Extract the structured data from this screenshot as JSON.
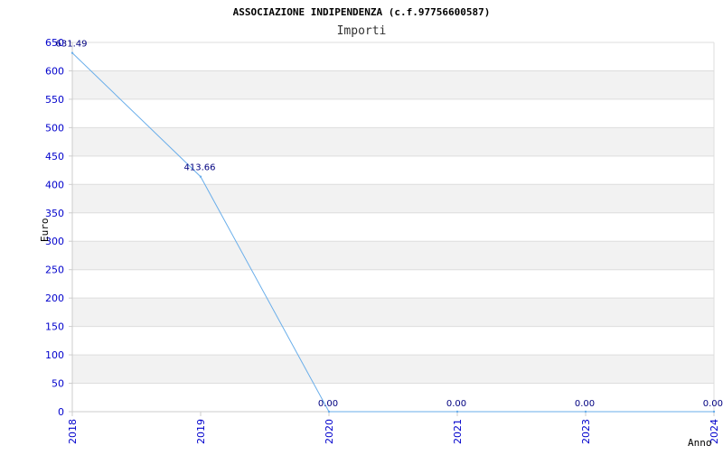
{
  "chart_data": {
    "type": "line",
    "title": "ASSOCIAZIONE INDIPENDENZA (c.f.97756600587)",
    "subtitle": "Importi",
    "xlabel": "Anno",
    "ylabel": "Euro",
    "categories": [
      "2018",
      "2019",
      "2020",
      "2021",
      "2023",
      "2024"
    ],
    "series": [
      {
        "values": [
          631.49,
          413.66,
          0,
          0,
          0,
          0
        ]
      }
    ],
    "data_labels": [
      "631.49",
      "413.66",
      "0.00",
      "0.00",
      "0.00",
      "0.00"
    ],
    "ylim": [
      0,
      650
    ],
    "yticks": [
      0,
      50,
      100,
      150,
      200,
      250,
      300,
      350,
      400,
      450,
      500,
      550,
      600,
      650
    ],
    "grid": true,
    "line_color": "#6aaeea",
    "band_color": "#f2f2f2",
    "grid_color": "#dddddd",
    "tick_color": "#0000cc",
    "label_color": "#000080"
  }
}
